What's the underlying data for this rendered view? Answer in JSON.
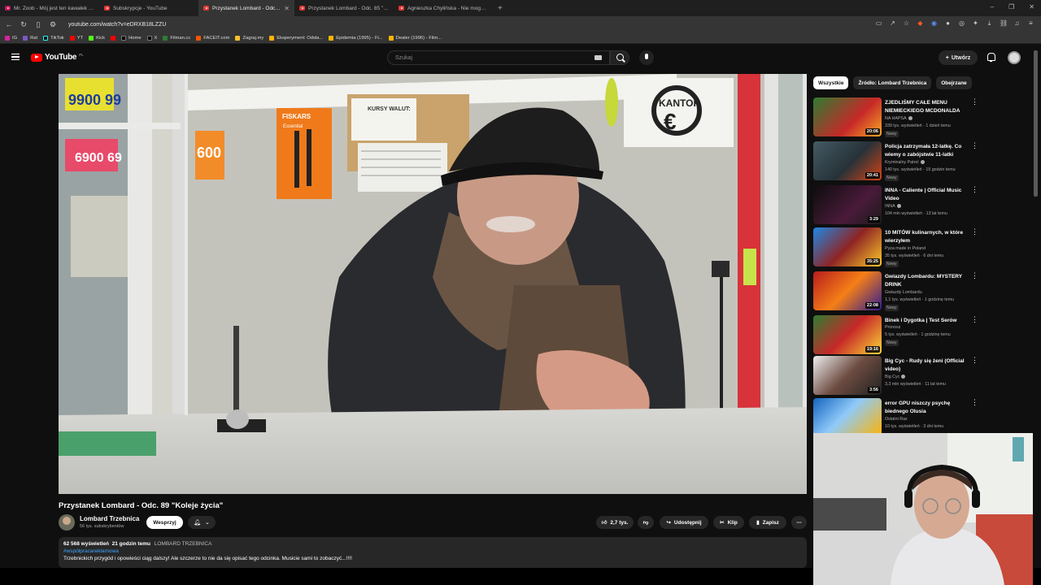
{
  "browser": {
    "tabs": [
      {
        "title": "Mr. Zoob - Mój jest ten kawałek podłogi",
        "active": false
      },
      {
        "title": "Subskrypcje - YouTube",
        "active": false
      },
      {
        "title": "Przystanek Lombard - Odc. 89 \"Koleje życia\"",
        "active": true
      },
      {
        "title": "Przystanek Lombard - Odc. 85 \"Via Vi...",
        "active": false
      },
      {
        "title": "Agnieszka Chylińska - Nie mogę Ci...",
        "active": false
      }
    ],
    "url": "youtube.com/watch?v=eDRXB18LZZU",
    "bookmarks": [
      "IG",
      "Rat",
      "TikTok",
      "YT",
      "Kick",
      "",
      "Home",
      "X",
      "Filman.cc",
      "FACEIT.com",
      "Zagraj.my",
      "Eksperyment: Odsła...",
      "Epidemia (1995) - Fi...",
      "Dealer (1996) - Film..."
    ]
  },
  "header": {
    "logo": "YouTube",
    "logo_region": "PL",
    "search_placeholder": "Szukaj",
    "create_label": "Utwórz"
  },
  "video": {
    "title": "Przystanek Lombard - Odc. 89 \"Koleje życia\"",
    "channel": "Lombard Trzebnica",
    "subscribers": "56 tys. subskrybentów",
    "support_label": "Wesprzyj",
    "likes": "2,7 tys.",
    "share_label": "Udostępnij",
    "clip_label": "Klip",
    "save_label": "Zapisz",
    "scene": {
      "sign_kantor": "KANTOR",
      "sign_fiskars": "FISKARS",
      "sign_essential": "Essential",
      "sign_kursy": "KURSY WALUT:",
      "sign_600": "600",
      "sign_9900": "9900 99",
      "sign_6900": "6900 69"
    }
  },
  "description": {
    "views": "62 568 wyświetleń",
    "time": "21 godzin temu",
    "caption": "LOMBARD TRZEBNICA",
    "hashtag": "#współpracareklamowa",
    "text": "Trzebnickich przygód i opowieści ciąg dalszy! Ale szczerze to nie da się opisać tego odcinka. Musicie sami to zobaczyć...!!!!"
  },
  "chips": [
    "Wszystkie",
    "Źródło: Lombard Trzebnica",
    "Obejrzane"
  ],
  "recommendations": [
    {
      "title": "ZJEDLIŚMY CAŁE MENU NIEMIECKIEGO MCDONALDA",
      "channel": "NA HAPSA",
      "meta": "339 tys. wyświetleń · 1 dzień temu",
      "badge": "Nowy",
      "duration": "20:06",
      "thumb_color": "#2e7d32",
      "verified": true
    },
    {
      "title": "Policja zatrzymała 12-latkę. Co wiemy o zabójstwie 11-latki",
      "channel": "Kryminalny Patrol",
      "meta": "140 tys. wyświetleń · 19 godzin temu",
      "badge": "Nowy",
      "duration": "20:41",
      "thumb_color": "#37474f",
      "verified": true
    },
    {
      "title": "INNA - Caliente | Official Music Video",
      "channel": "INNA",
      "meta": "104 mln wyświetleń · 13 lat temu",
      "badge": "",
      "duration": "3:29",
      "thumb_color": "#1b1b1b",
      "verified": true
    },
    {
      "title": "10 MITÓW kulinarnych, w które wierzyłem",
      "channel": "Pyza made in Poland",
      "meta": "35 tys. wyświetleń · 6 dni temu",
      "badge": "Nowy",
      "duration": "35:25",
      "thumb_color": "#8e2424",
      "verified": false
    },
    {
      "title": "Gwiazdy Lombardu: MYSTERY DRINK",
      "channel": "Gwiazdy Lombardu",
      "meta": "1,1 tys. wyświetleń · 1 godzinę temu",
      "badge": "Nowy",
      "duration": "22:08",
      "thumb_color": "#b71c1c",
      "verified": false
    },
    {
      "title": "Binek i Dygotka | Test Serów",
      "channel": "Pronosz",
      "meta": "5 tys. wyświetleń · 1 godzinę temu",
      "badge": "Nowy",
      "duration": "19:16",
      "thumb_color": "#c62828",
      "verified": false
    },
    {
      "title": "Big Cyc - Rudy się żeni (Official video)",
      "channel": "Big Cyc",
      "meta": "3,3 mln wyświetleń · 11 lat temu",
      "badge": "",
      "duration": "3:56",
      "thumb_color": "#6d4c41",
      "verified": true
    },
    {
      "title": "error GPU niszczy psychę biednego Olusia",
      "channel": "Ostatni Raz",
      "meta": "10 tys. wyświetleń · 3 dni temu",
      "badge": "",
      "duration": "",
      "thumb_color": "#1565c0",
      "verified": false
    }
  ]
}
